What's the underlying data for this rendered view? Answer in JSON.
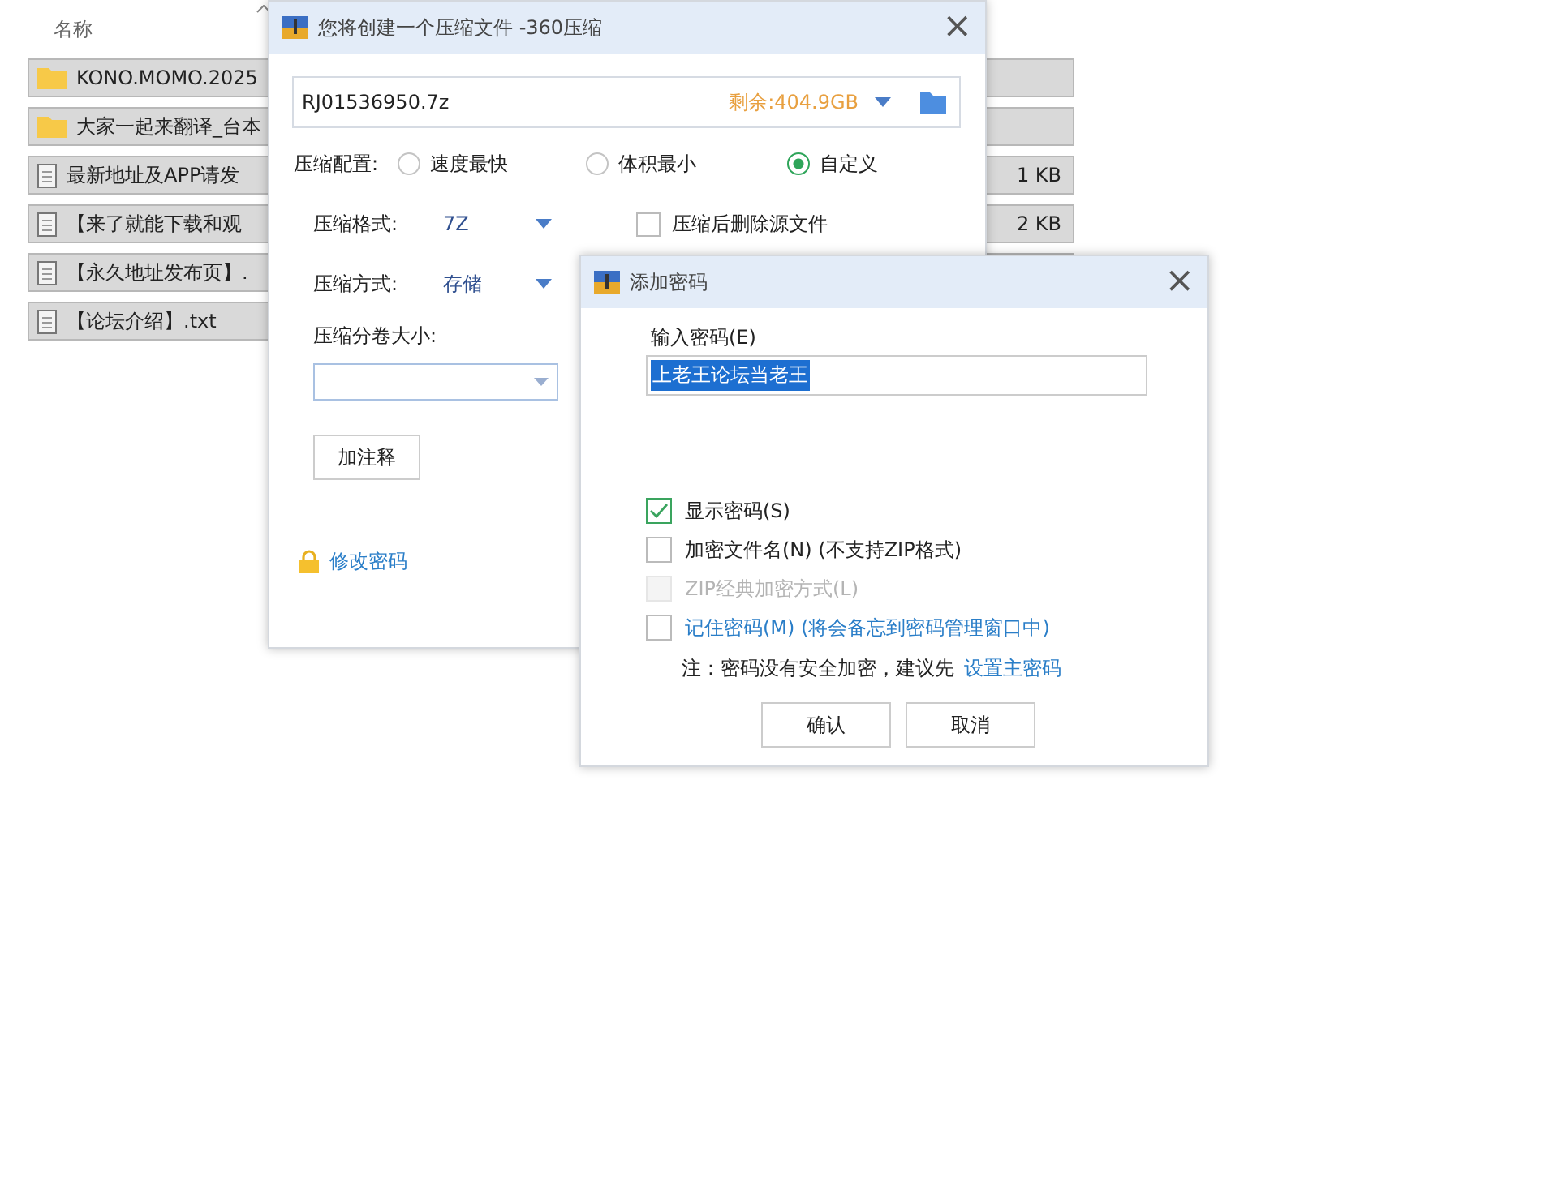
{
  "file_list": {
    "column": "名称",
    "rows": [
      {
        "kind": "folder",
        "name": "KONO.MOMO.2025"
      },
      {
        "kind": "folder",
        "name": "大家一起来翻译_台本"
      },
      {
        "kind": "file",
        "name": "最新地址及APP请发",
        "size": "1 KB"
      },
      {
        "kind": "file",
        "name": "【来了就能下载和观",
        "size": "2 KB"
      },
      {
        "kind": "file",
        "name": "【永久地址发布页】."
      },
      {
        "kind": "file",
        "name": "【论坛介绍】.txt"
      }
    ]
  },
  "compress_dialog": {
    "title": "您将创建一个压缩文件 -360压缩",
    "close": "×",
    "path": "RJ01536950.7z",
    "free_space": "剩余:404.9GB",
    "profile_label": "压缩配置:",
    "profiles": [
      {
        "label": "速度最快",
        "selected": false
      },
      {
        "label": "体积最小",
        "selected": false
      },
      {
        "label": "自定义",
        "selected": true
      }
    ],
    "format_label": "压缩格式:",
    "format": "7Z",
    "delete_source": {
      "label": "压缩后删除源文件",
      "checked": false
    },
    "method_label": "压缩方式:",
    "method": "存储",
    "split_label": "压缩分卷大小:",
    "comment_button": "加注释",
    "change_password": "修改密码"
  },
  "password_dialog": {
    "title": "添加密码",
    "close": "×",
    "input_label": "输入密码(E)",
    "password": "上老王论坛当老王",
    "password_selected": true,
    "options": [
      {
        "kind": "normal",
        "label": "显示密码(S)",
        "checked": true,
        "disabled": false
      },
      {
        "kind": "normal",
        "label": "加密文件名(N) (不支持ZIP格式)",
        "checked": false,
        "disabled": false
      },
      {
        "kind": "normal",
        "label": "ZIP经典加密方式(L)",
        "checked": false,
        "disabled": true
      },
      {
        "kind": "link",
        "label": "记住密码(M) (将会备忘到密码管理窗口中)",
        "checked": false,
        "disabled": false
      }
    ],
    "note": "注：密码没有安全加密，建议先",
    "note_link": "设置主密码",
    "buttons": [
      "确认",
      "取消"
    ]
  }
}
